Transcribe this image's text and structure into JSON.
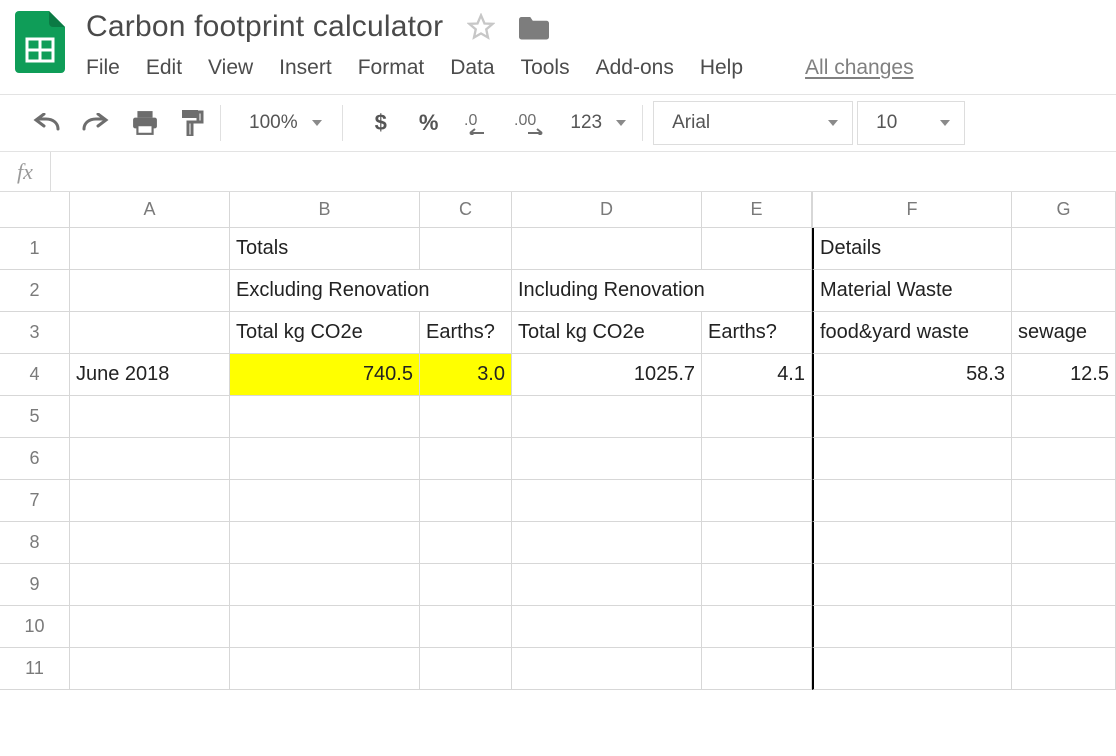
{
  "doc": {
    "title": "Carbon footprint calculator"
  },
  "menus": {
    "file": "File",
    "edit": "Edit",
    "view": "View",
    "insert": "Insert",
    "format": "Format",
    "data": "Data",
    "tools": "Tools",
    "addons": "Add-ons",
    "help": "Help",
    "saved": "All changes"
  },
  "toolbar": {
    "zoom": "100%",
    "format_num": "123",
    "font": "Arial",
    "font_size": "10"
  },
  "fx": {
    "label": "fx",
    "value": ""
  },
  "columns": [
    "A",
    "B",
    "C",
    "D",
    "E",
    "F",
    "G"
  ],
  "rows": [
    "1",
    "2",
    "3",
    "4",
    "5",
    "6",
    "7",
    "8",
    "9",
    "10",
    "11"
  ],
  "cells": {
    "B1": "Totals",
    "F1": "Details",
    "B2": "Excluding Renovation",
    "D2": "Including Renovation",
    "F2": "Material Waste",
    "B3": "Total kg CO2e",
    "C3": "Earths?",
    "D3": "Total kg CO2e",
    "E3": "Earths?",
    "F3": "food&yard waste",
    "G3": "sewage",
    "A4": "June 2018",
    "B4": "740.5",
    "C4": "3.0",
    "D4": "1025.7",
    "E4": "4.1",
    "F4": "58.3",
    "G4": "12.5"
  },
  "chart_data": {
    "type": "table",
    "title": "Carbon footprint calculator",
    "rows": [
      {
        "period": "June 2018",
        "totals": {
          "excluding_renovation": {
            "total_kg_co2e": 740.5,
            "earths": 3.0
          },
          "including_renovation": {
            "total_kg_co2e": 1025.7,
            "earths": 4.1
          }
        },
        "details": {
          "material_waste": {
            "food_and_yard_waste": 58.3,
            "sewage": 12.5
          }
        }
      }
    ]
  }
}
